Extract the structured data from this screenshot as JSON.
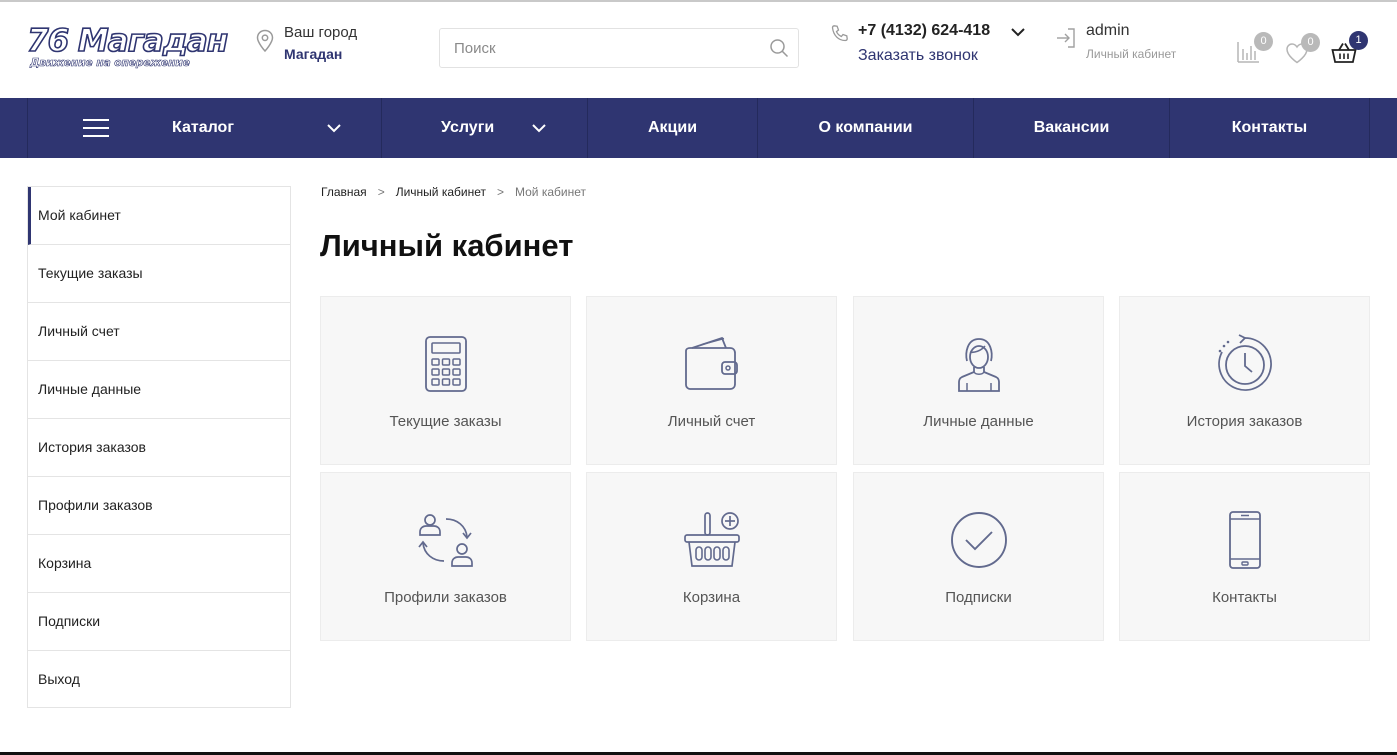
{
  "logo": {
    "main": "76 Магадан",
    "tagline": "Движение на опережение"
  },
  "city": {
    "label": "Ваш город",
    "value": "Магадан"
  },
  "search": {
    "placeholder": "Поиск",
    "value": ""
  },
  "phone": {
    "number": "+7 (4132) 624-418",
    "callback": "Заказать звонок"
  },
  "account": {
    "name": "admin",
    "sub": "Личный кабинет"
  },
  "counters": {
    "compare": "0",
    "favorites": "0",
    "cart": "1"
  },
  "colors": {
    "brand": "#2f3571",
    "badge_grey": "#b9b9b9",
    "tile_bg": "#f7f7f7"
  },
  "nav": {
    "items": [
      {
        "label": "Каталог",
        "has_dropdown": true
      },
      {
        "label": "Услуги",
        "has_dropdown": true
      },
      {
        "label": "Акции",
        "has_dropdown": false
      },
      {
        "label": "О компании",
        "has_dropdown": false
      },
      {
        "label": "Вакансии",
        "has_dropdown": false
      },
      {
        "label": "Контакты",
        "has_dropdown": false
      }
    ]
  },
  "sidebar": {
    "items": [
      {
        "label": "Мой кабинет",
        "active": true
      },
      {
        "label": "Текущие заказы",
        "active": false
      },
      {
        "label": "Личный счет",
        "active": false
      },
      {
        "label": "Личные данные",
        "active": false
      },
      {
        "label": "История заказов",
        "active": false
      },
      {
        "label": "Профили заказов",
        "active": false
      },
      {
        "label": "Корзина",
        "active": false
      },
      {
        "label": "Подписки",
        "active": false
      },
      {
        "label": "Выход",
        "active": false
      }
    ]
  },
  "breadcrumbs": [
    "Главная",
    "Личный кабинет",
    "Мой кабинет"
  ],
  "page_title": "Личный кабинет",
  "tiles": [
    {
      "label": "Текущие заказы",
      "icon": "calculator-icon"
    },
    {
      "label": "Личный счет",
      "icon": "wallet-icon"
    },
    {
      "label": "Личные данные",
      "icon": "person-icon"
    },
    {
      "label": "История заказов",
      "icon": "history-clock-icon"
    },
    {
      "label": "Профили заказов",
      "icon": "profiles-exchange-icon"
    },
    {
      "label": "Корзина",
      "icon": "basket-add-icon"
    },
    {
      "label": "Подписки",
      "icon": "check-circle-icon"
    },
    {
      "label": "Контакты",
      "icon": "smartphone-icon"
    }
  ]
}
